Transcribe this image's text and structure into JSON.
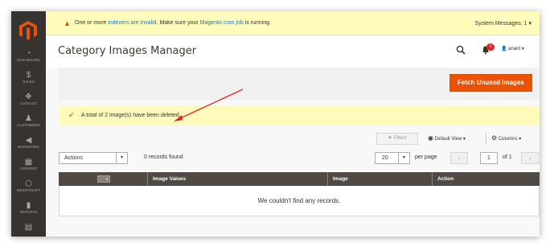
{
  "colors": {
    "sidebar": "#373330",
    "brand_orange": "#eb5202",
    "notice_yellow": "#fffbbb",
    "grid_header": "#514943",
    "link_blue": "#1979c3",
    "success_green": "#79a22e",
    "annotation_red": "#e22626"
  },
  "sidebar": {
    "logo_icon": "magento-logo-icon",
    "items": [
      {
        "label": "DASHBOARD",
        "icon": "speedometer-icon",
        "glyph": "◔"
      },
      {
        "label": "SALES",
        "icon": "dollar-icon",
        "glyph": "$"
      },
      {
        "label": "CATALOG",
        "icon": "cube-icon",
        "glyph": "❖"
      },
      {
        "label": "CUSTOMERS",
        "icon": "person-icon",
        "glyph": "♟"
      },
      {
        "label": "MARKETING",
        "icon": "megaphone-icon",
        "glyph": "◀"
      },
      {
        "label": "CONTENT",
        "icon": "layout-icon",
        "glyph": "▦"
      },
      {
        "label": "MSINFOSOFT",
        "icon": "hexagon-icon",
        "glyph": "⬡"
      },
      {
        "label": "REPORTS",
        "icon": "bar-chart-icon",
        "glyph": "▮"
      },
      {
        "label": "",
        "icon": "store-icon",
        "glyph": "▤"
      }
    ]
  },
  "system_bar": {
    "message_prefix": "One or more ",
    "indexers_link": "indexers are invalid",
    "message_middle": ". Make sure your ",
    "cron_link": "Magento cron job",
    "message_suffix": " is running.",
    "system_messages": "System Messages: 1"
  },
  "header": {
    "title": "Category Images Manager",
    "notifications_count": "1",
    "user_name": "anant"
  },
  "action_bar": {
    "fetch_button": "Fetch Unused Images"
  },
  "notice": {
    "text": "A total of 2 image(s) have been deleted."
  },
  "toolbar": {
    "filters": "Filters",
    "view": "Default View",
    "columns": "Columns",
    "actions": "Actions",
    "records_found": "0 records found",
    "per_page_value": "20",
    "per_page_label": "per page",
    "page_value": "1",
    "of_pages": "of 1"
  },
  "grid": {
    "columns": [
      "Image Values",
      "Image",
      "Action"
    ],
    "empty_message": "We couldn't find any records."
  }
}
